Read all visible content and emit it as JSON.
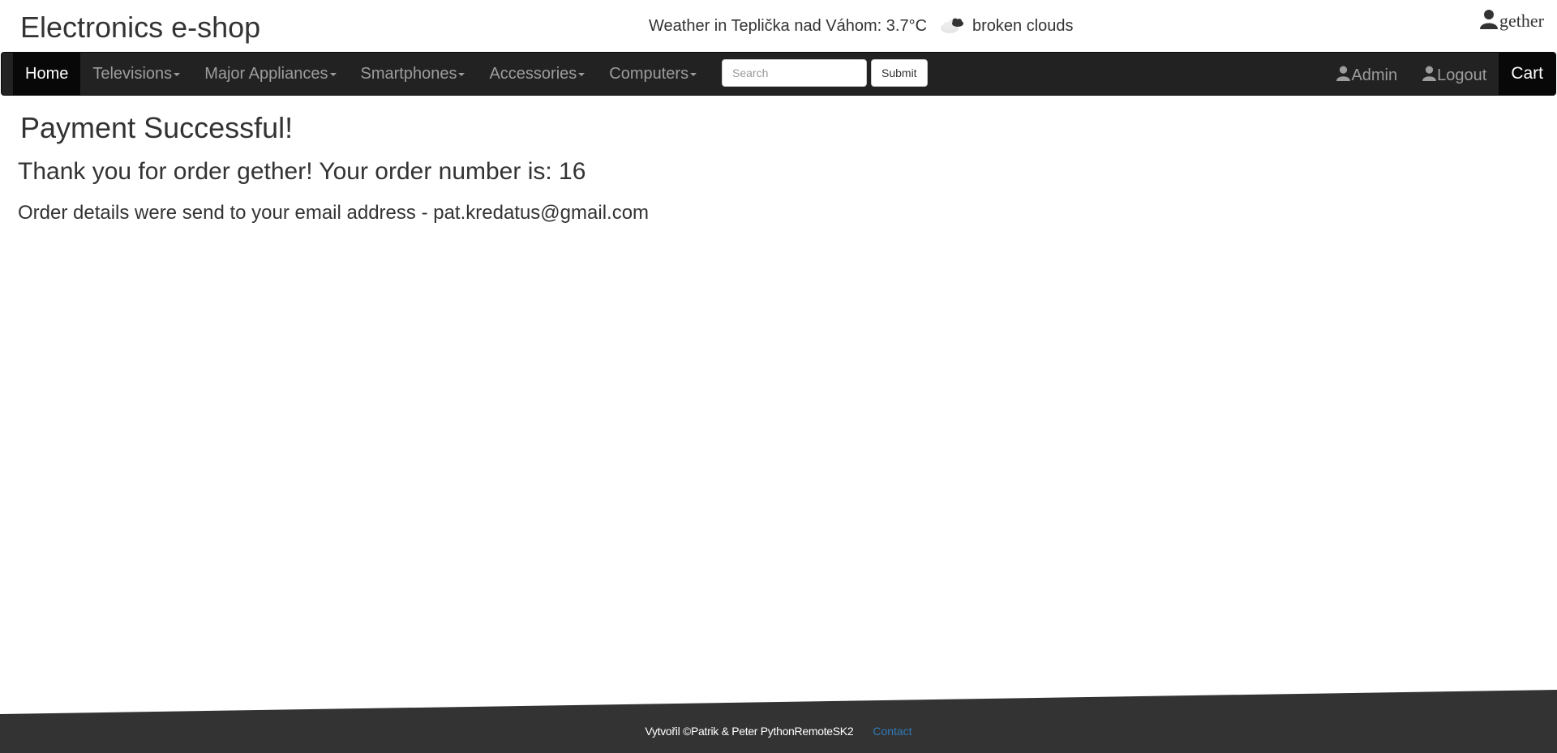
{
  "header": {
    "brand": "Electronics e-shop",
    "weather_text": "Weather in Teplička nad Váhom: 3.7°C",
    "weather_condition": "broken clouds",
    "username": "gether"
  },
  "navbar": {
    "home": "Home",
    "menus": [
      {
        "label": "Televisions"
      },
      {
        "label": "Major Appliances"
      },
      {
        "label": "Smartphones"
      },
      {
        "label": "Accessories"
      },
      {
        "label": "Computers"
      }
    ],
    "search_placeholder": "Search",
    "submit_label": "Submit",
    "admin": "Admin",
    "logout": "Logout",
    "cart": "Cart"
  },
  "main": {
    "title": "Payment Successful!",
    "thanks": "Thank you for order gether! Your order number is: 16",
    "details": "Order details were send to your email address - pat.kredatus@gmail.com"
  },
  "footer": {
    "credit": "Vytvořil ©Patrik & Peter PythonRemoteSK2",
    "contact": "Contact"
  },
  "colors": {
    "navbar_bg": "#222222",
    "navbar_active_bg": "#080808",
    "nav_text": "#9d9d9d",
    "footer_bg": "#333333",
    "link": "#337ab7"
  },
  "icons": {
    "weather": "broken-clouds-icon",
    "user": "user-icon"
  }
}
